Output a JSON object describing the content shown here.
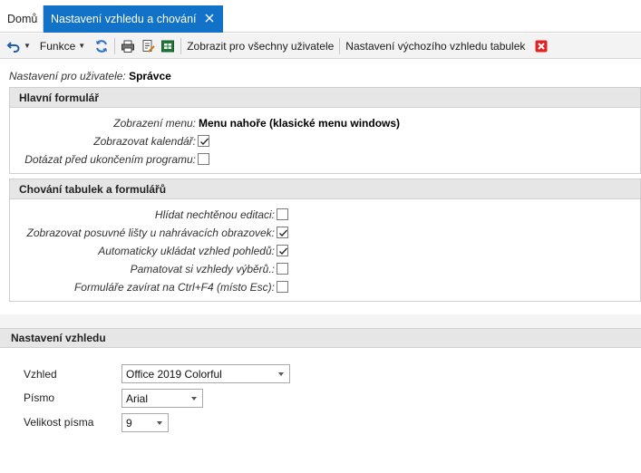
{
  "tabs": {
    "home": "Domů",
    "active": "Nastavení vzhledu a chování"
  },
  "toolbar": {
    "funkce": "Funkce",
    "show_all_users": "Zobrazit pro všechny uživatele",
    "default_table_look": "Nastavení výchozího vzhledu tabulek"
  },
  "user": {
    "label": "Nastavení pro uživatele:",
    "value": "Správce"
  },
  "main_form": {
    "title": "Hlavní formulář",
    "menu_label": "Zobrazení menu:",
    "menu_value": "Menu nahoře (klasické menu windows)",
    "calendar_label": "Zobrazovat kalendář:",
    "calendar_checked": true,
    "ask_exit_label": "Dotázat před ukončením programu:",
    "ask_exit_checked": false
  },
  "behavior": {
    "title": "Chování tabulek a formulářů",
    "items": [
      {
        "label": "Hlídat nechtěnou editaci:",
        "checked": false
      },
      {
        "label": "Zobrazovat posuvné lišty u nahrávacích obrazovek:",
        "checked": true
      },
      {
        "label": "Automaticky ukládat vzhled pohledů:",
        "checked": true
      },
      {
        "label": "Pamatovat si vzhledy výběrů.:",
        "checked": false
      },
      {
        "label": "Formuláře zavírat na Ctrl+F4 (místo Esc):",
        "checked": false
      }
    ]
  },
  "appearance": {
    "title": "Nastavení vzhledu",
    "theme_label": "Vzhled",
    "theme_value": "Office 2019 Colorful",
    "font_label": "Písmo",
    "font_value": "Arial",
    "size_label": "Velikost písma",
    "size_value": "9"
  },
  "colors": {
    "accent": "#1272c8",
    "close_red": "#e02424",
    "header_gray": "#e6e6e6"
  }
}
